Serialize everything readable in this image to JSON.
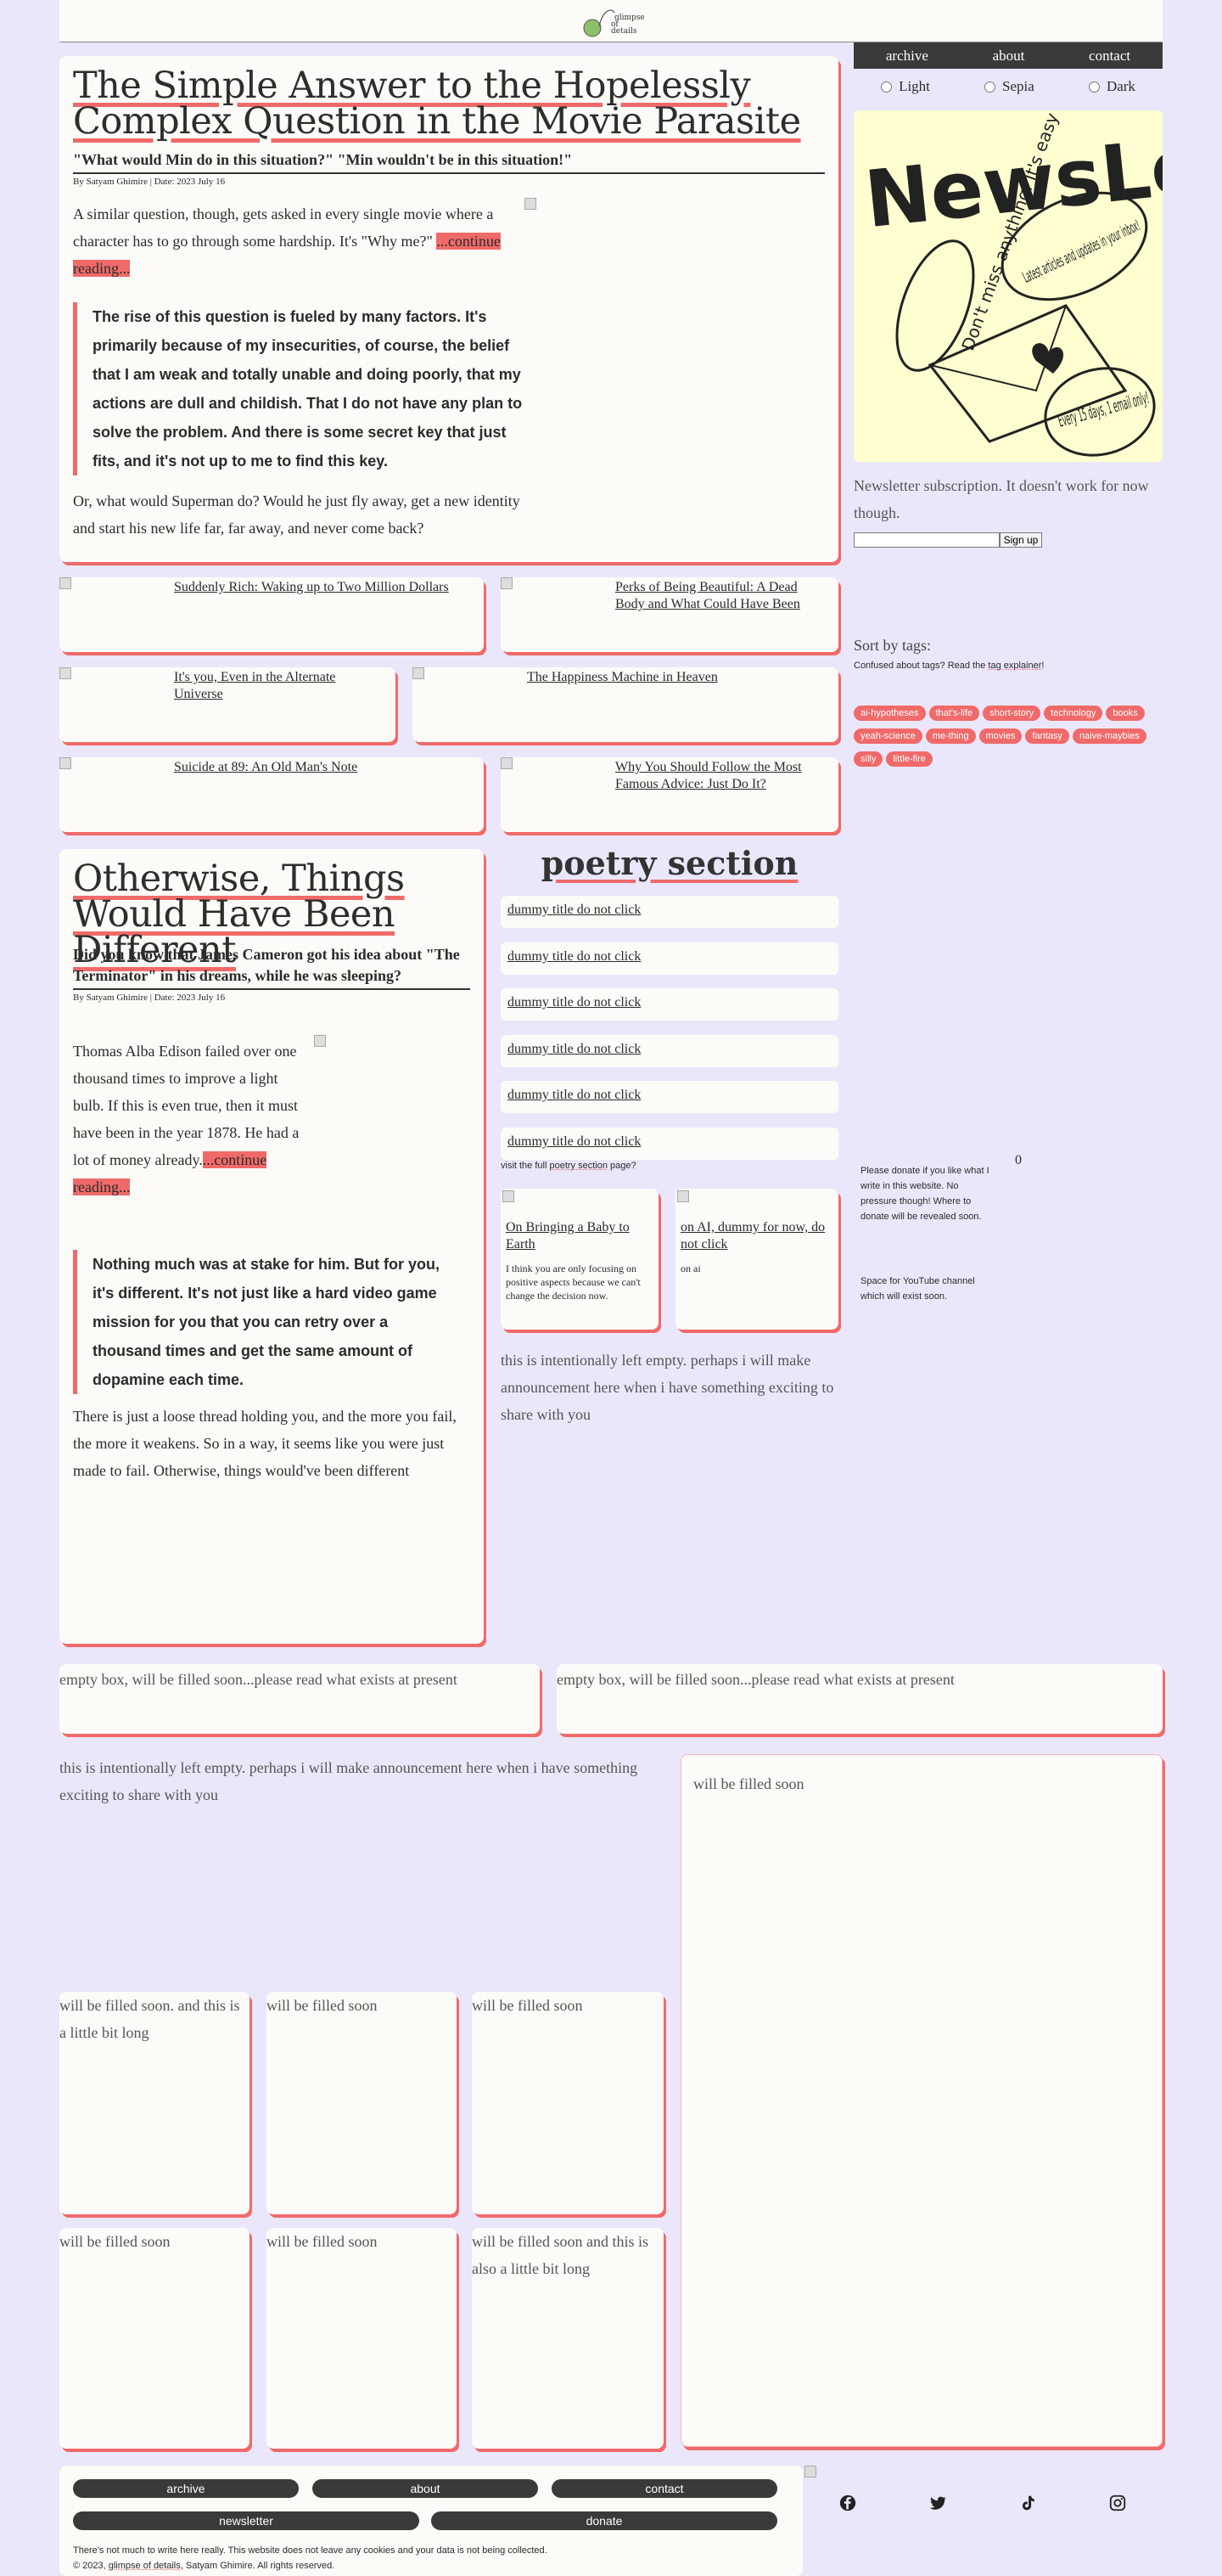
{
  "site": {
    "logo_text_1": "glimpse",
    "logo_text_2": "of",
    "logo_text_3": "details"
  },
  "nav": {
    "archive": "archive",
    "about": "about",
    "contact": "contact"
  },
  "themes": {
    "light": "Light",
    "sepia": "Sepia",
    "dark": "Dark"
  },
  "article1": {
    "title": "The Simple Answer to the Hopelessly Complex Question in the Movie Parasite",
    "subtitle": "\"What would Min do in this situation?\" \"Min wouldn't be in this situation!\"",
    "byline": "By Satyam Ghimire | Date: 2023 July 16",
    "body": "A similar question, though, gets asked in every single movie where a character has to go through some hardship. It's \"Why me?\"",
    "continue": "...continue reading...",
    "quote": "The rise of this question is fueled by many factors. It's primarily because of my insecurities, of course, the belief that I am weak and totally unable and doing poorly, that my actions are dull and childish. That I do not have any plan to solve the problem. And there is some secret key that just fits, and it's not up to me to find this key.",
    "tail": "Or, what would Superman do? Would he just fly away, get a new identity and start his new life far, far away, and never come back?"
  },
  "minis": [
    "Suddenly Rich: Waking up to Two Million Dollars",
    "Perks of Being Beautiful: A Dead Body and What Could Have Been",
    "It's you, Even in the Alternate Universe",
    "The Happiness Machine in Heaven",
    "Suicide at 89: An Old Man's Note",
    "Why You Should Follow the Most Famous Advice: Just Do It?"
  ],
  "article2": {
    "title": "Otherwise, Things Would Have Been Different",
    "subtitle": "Did you know that James Cameron got his idea about \"The Terminator\" in his dreams, while he was sleeping?",
    "byline": "By Satyam Ghimire | Date: 2023 July 16",
    "body": "Thomas Alba Edison failed over one thousand times to improve a light bulb. If this is even true, then it must have been in the year 1878. He had a lot of money already.",
    "continue": "...continue reading...",
    "quote": "Nothing much was at stake for him. But for you, it's different. It's not just like a hard video game mission for you that you can retry over a thousand times and get the same amount of dopamine each time.",
    "tail": "There is just a loose thread holding you, and the more you fail, the more it weakens. So in a way, it seems like you were just made to fail. Otherwise, things would've been different"
  },
  "newsletter": {
    "art_title": "NewsLetter",
    "bubble1": "Don't miss anything. It's easy",
    "bubble2": "Latest articles and updates in your inbox!",
    "bubble3": "Every 15 days, 1 email only!",
    "desc": "Newsletter subscription. It doesn't work for now though.",
    "input_placeholder": "",
    "signup": "Sign up"
  },
  "tags": {
    "heading": "Sort by tags:",
    "note_prefix": "Confused about tags? Read the ",
    "note_link": "tag explainer",
    "note_suffix": "!",
    "items": [
      "ai-hypotheses",
      "that's-life",
      "short-story",
      "technology",
      "books",
      "yeah-science",
      "me-thing",
      "movies",
      "fantasy",
      "naive-maybies",
      "silly",
      "little-fire"
    ]
  },
  "poetry": {
    "heading": "poetry section",
    "items": [
      "dummy title do not click",
      "dummy title do not click",
      "dummy title do not click",
      "dummy title do not click",
      "dummy title do not click",
      "dummy title do not click"
    ],
    "visit_prefix": "visit the full ",
    "visit_link": "poetry section",
    "visit_suffix": " page?"
  },
  "cards": [
    {
      "title": "On Bringing a Baby to Earth",
      "desc": "I think you are only focusing on positive aspects because we can't change the decision now."
    },
    {
      "title": "on AI, dummy for now, do not click",
      "desc": "on ai"
    }
  ],
  "side": {
    "donate": "Please donate if you like what I write in this website. No pressure though! Where to donate will be revealed soon.",
    "counter": "0",
    "youtube": "Space for YouTube channel which will exist soon."
  },
  "announce": "this is intentionally left empty. perhaps i will make announcement here when i have something exciting to share with you",
  "emptybox": "empty box, will be filled soon...please read what exists at present",
  "fill": {
    "big": "will be filled soon",
    "c1": "will be filled soon. and this is a little bit long",
    "c2": "will be filled soon",
    "c3": "will be filled soon",
    "c4": "will be filled soon",
    "c5": "will be filled soon",
    "c6": "will be filled soon and this is also a little bit long"
  },
  "footer": {
    "archive": "archive",
    "about": "about",
    "contact": "contact",
    "newsletter": "newsletter",
    "donate": "donate",
    "note": "There's not much to write here really. This website does not leave any cookies and your data is not being collected.",
    "copy_prefix": "© 2023, ",
    "copy_link": "glimpse of details",
    "copy_suffix": ", Satyam Ghimire. All rights reserved.",
    "social": [
      "facebook-icon",
      "twitter-icon",
      "tiktok-icon",
      "instagram-icon"
    ]
  },
  "colors": {
    "accent": "#f06a6a",
    "bg": "#ebe7fb",
    "card": "#fdfbf8",
    "nav": "#3a3a3a"
  }
}
